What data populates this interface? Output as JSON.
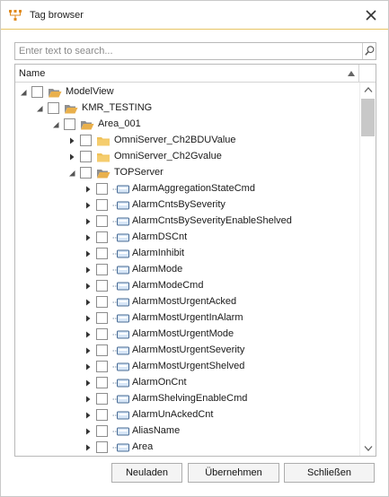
{
  "window": {
    "title": "Tag browser",
    "accent_color": "#e7c463"
  },
  "icons": {
    "app": "tag-browser-icon",
    "close": "close-icon",
    "search": "search-icon",
    "folder": "folder-icon",
    "folder_open": "folder-open-icon",
    "tag": "tag-icon"
  },
  "search": {
    "placeholder": "Enter text to search...",
    "value": ""
  },
  "grid": {
    "column_header": "Name",
    "sort": "ascending",
    "rows": [
      {
        "label": "ModelView",
        "level": 0,
        "expanded": true,
        "kind": "folder-open"
      },
      {
        "label": "KMR_TESTING",
        "level": 1,
        "expanded": true,
        "kind": "folder-open"
      },
      {
        "label": "Area_001",
        "level": 2,
        "expanded": true,
        "kind": "folder-open"
      },
      {
        "label": "OmniServer_Ch2BDUValue",
        "level": 3,
        "expanded": false,
        "kind": "folder"
      },
      {
        "label": "OmniServer_Ch2Gvalue",
        "level": 3,
        "expanded": false,
        "kind": "folder"
      },
      {
        "label": "TOPServer",
        "level": 3,
        "expanded": true,
        "kind": "folder-open"
      },
      {
        "label": "AlarmAggregationStateCmd",
        "level": 4,
        "expanded": false,
        "kind": "tag"
      },
      {
        "label": "AlarmCntsBySeverity",
        "level": 4,
        "expanded": false,
        "kind": "tag"
      },
      {
        "label": "AlarmCntsBySeverityEnableShelved",
        "level": 4,
        "expanded": false,
        "kind": "tag"
      },
      {
        "label": "AlarmDSCnt",
        "level": 4,
        "expanded": false,
        "kind": "tag"
      },
      {
        "label": "AlarmInhibit",
        "level": 4,
        "expanded": false,
        "kind": "tag"
      },
      {
        "label": "AlarmMode",
        "level": 4,
        "expanded": false,
        "kind": "tag"
      },
      {
        "label": "AlarmModeCmd",
        "level": 4,
        "expanded": false,
        "kind": "tag"
      },
      {
        "label": "AlarmMostUrgentAcked",
        "level": 4,
        "expanded": false,
        "kind": "tag"
      },
      {
        "label": "AlarmMostUrgentInAlarm",
        "level": 4,
        "expanded": false,
        "kind": "tag"
      },
      {
        "label": "AlarmMostUrgentMode",
        "level": 4,
        "expanded": false,
        "kind": "tag"
      },
      {
        "label": "AlarmMostUrgentSeverity",
        "level": 4,
        "expanded": false,
        "kind": "tag"
      },
      {
        "label": "AlarmMostUrgentShelved",
        "level": 4,
        "expanded": false,
        "kind": "tag"
      },
      {
        "label": "AlarmOnCnt",
        "level": 4,
        "expanded": false,
        "kind": "tag"
      },
      {
        "label": "AlarmShelvingEnableCmd",
        "level": 4,
        "expanded": false,
        "kind": "tag"
      },
      {
        "label": "AlarmUnAckedCnt",
        "level": 4,
        "expanded": false,
        "kind": "tag"
      },
      {
        "label": "AliasName",
        "level": 4,
        "expanded": false,
        "kind": "tag"
      },
      {
        "label": "Area",
        "level": 4,
        "expanded": false,
        "kind": "tag"
      }
    ]
  },
  "buttons": {
    "reload": "Neuladen",
    "apply": "Übernehmen",
    "close": "Schließen"
  }
}
